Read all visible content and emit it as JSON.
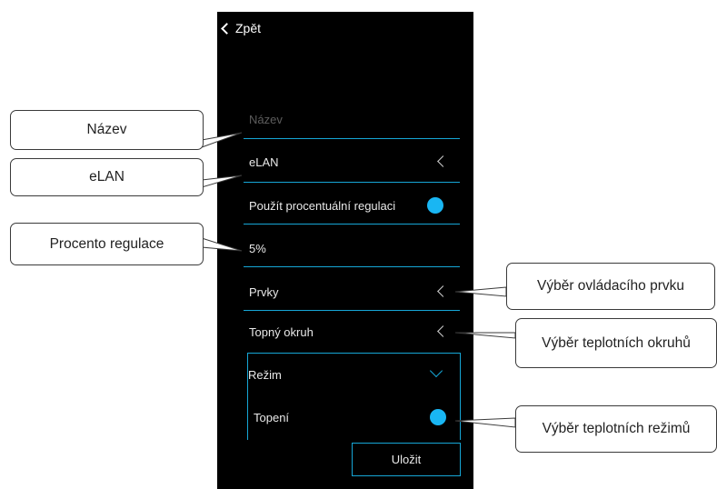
{
  "app": {
    "back_label": "Zpět",
    "fields": {
      "name_placeholder": "Název",
      "elan_label": "eLAN",
      "percent_toggle_label": "Použít procentuální regulaci",
      "percent_value": "5%",
      "elements_label": "Prvky",
      "heating_circuit_label": "Topný okruh",
      "mode_label": "Režim",
      "heating_label": "Topení"
    },
    "save_label": "Uložit"
  },
  "callouts": {
    "name": "Název",
    "elan": "eLAN",
    "percent": "Procento regulace",
    "control_element": "Výběr ovládacího prvku",
    "heating_circuits": "Výběr teplotních okruhů",
    "heating_modes": "Výběr teplotních režimů"
  },
  "colors": {
    "accent": "#16a6d6",
    "toggle": "#19b6f3",
    "screen_bg": "#000000"
  },
  "icons": {
    "back": "chevron-left-icon",
    "elan": "chevron-left-icon",
    "elements": "chevron-left-icon",
    "heating_circuit": "chevron-left-icon",
    "mode": "chevron-down-icon"
  }
}
